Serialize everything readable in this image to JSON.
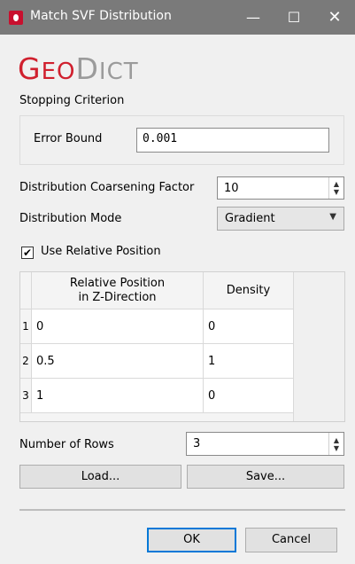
{
  "window": {
    "title": "Match SVF Distribution",
    "icon": "geodict-app-icon",
    "controls": {
      "minimize": "—",
      "maximize": "☐",
      "close": "✕"
    }
  },
  "logo": {
    "first": "G",
    "rest1": "EO",
    "second": "D",
    "rest2": "ICT",
    "colors": {
      "geo": "#d0202e",
      "dict": "#9b9b9b"
    }
  },
  "stopping": {
    "group_label": "Stopping Criterion",
    "error_bound_label": "Error Bound",
    "error_bound_value": "0.001"
  },
  "coarsening": {
    "label": "Distribution Coarsening Factor",
    "value": "10"
  },
  "mode": {
    "label": "Distribution Mode",
    "value": "Gradient"
  },
  "use_relative": {
    "label": "Use Relative Position",
    "checked": true,
    "mark": "✔"
  },
  "table": {
    "headers": {
      "relpos": "Relative Position\nin Z-Direction",
      "density": "Density"
    },
    "rows": [
      {
        "index": "1",
        "relpos": "0",
        "density": "0"
      },
      {
        "index": "2",
        "relpos": "0.5",
        "density": "1"
      },
      {
        "index": "3",
        "relpos": "1",
        "density": "0"
      }
    ]
  },
  "num_rows": {
    "label": "Number of Rows",
    "value": "3"
  },
  "buttons": {
    "load": "Load...",
    "save": "Save...",
    "ok": "OK",
    "cancel": "Cancel"
  },
  "spin_arrows": {
    "up": "▲",
    "down": "▼"
  },
  "select_caret": "▼",
  "accent": "#0078d7"
}
